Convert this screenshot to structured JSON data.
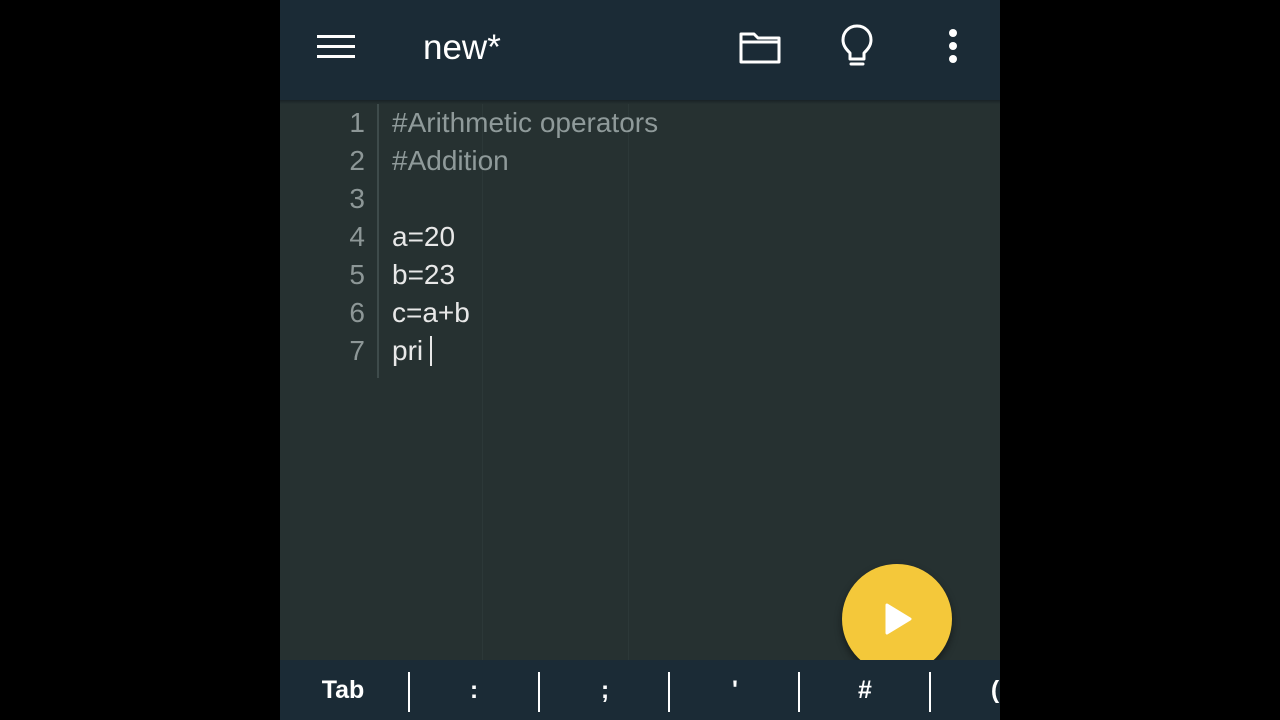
{
  "app_bar": {
    "title": "new*",
    "icons": {
      "menu": "hamburger-menu-icon",
      "folder": "folder-icon",
      "hint": "lightbulb-icon",
      "overflow": "more-vert-icon"
    },
    "background": "#1b2b36"
  },
  "editor": {
    "background": "#263131",
    "lines": [
      {
        "number": "1",
        "text": "#Arithmetic operators",
        "kind": "comment"
      },
      {
        "number": "2",
        "text": "#Addition",
        "kind": "comment"
      },
      {
        "number": "3",
        "text": "",
        "kind": "code"
      },
      {
        "number": "4",
        "text": "a=20",
        "kind": "code"
      },
      {
        "number": "5",
        "text": "b=23",
        "kind": "code"
      },
      {
        "number": "6",
        "text": "c=a+b",
        "kind": "code"
      },
      {
        "number": "7",
        "text": "pri",
        "kind": "code"
      }
    ]
  },
  "run_button": {
    "icon": "play-icon",
    "color": "#f4c83a"
  },
  "extra_keys": {
    "keys": [
      "Tab",
      ":",
      ";",
      "'",
      "#",
      "("
    ]
  }
}
